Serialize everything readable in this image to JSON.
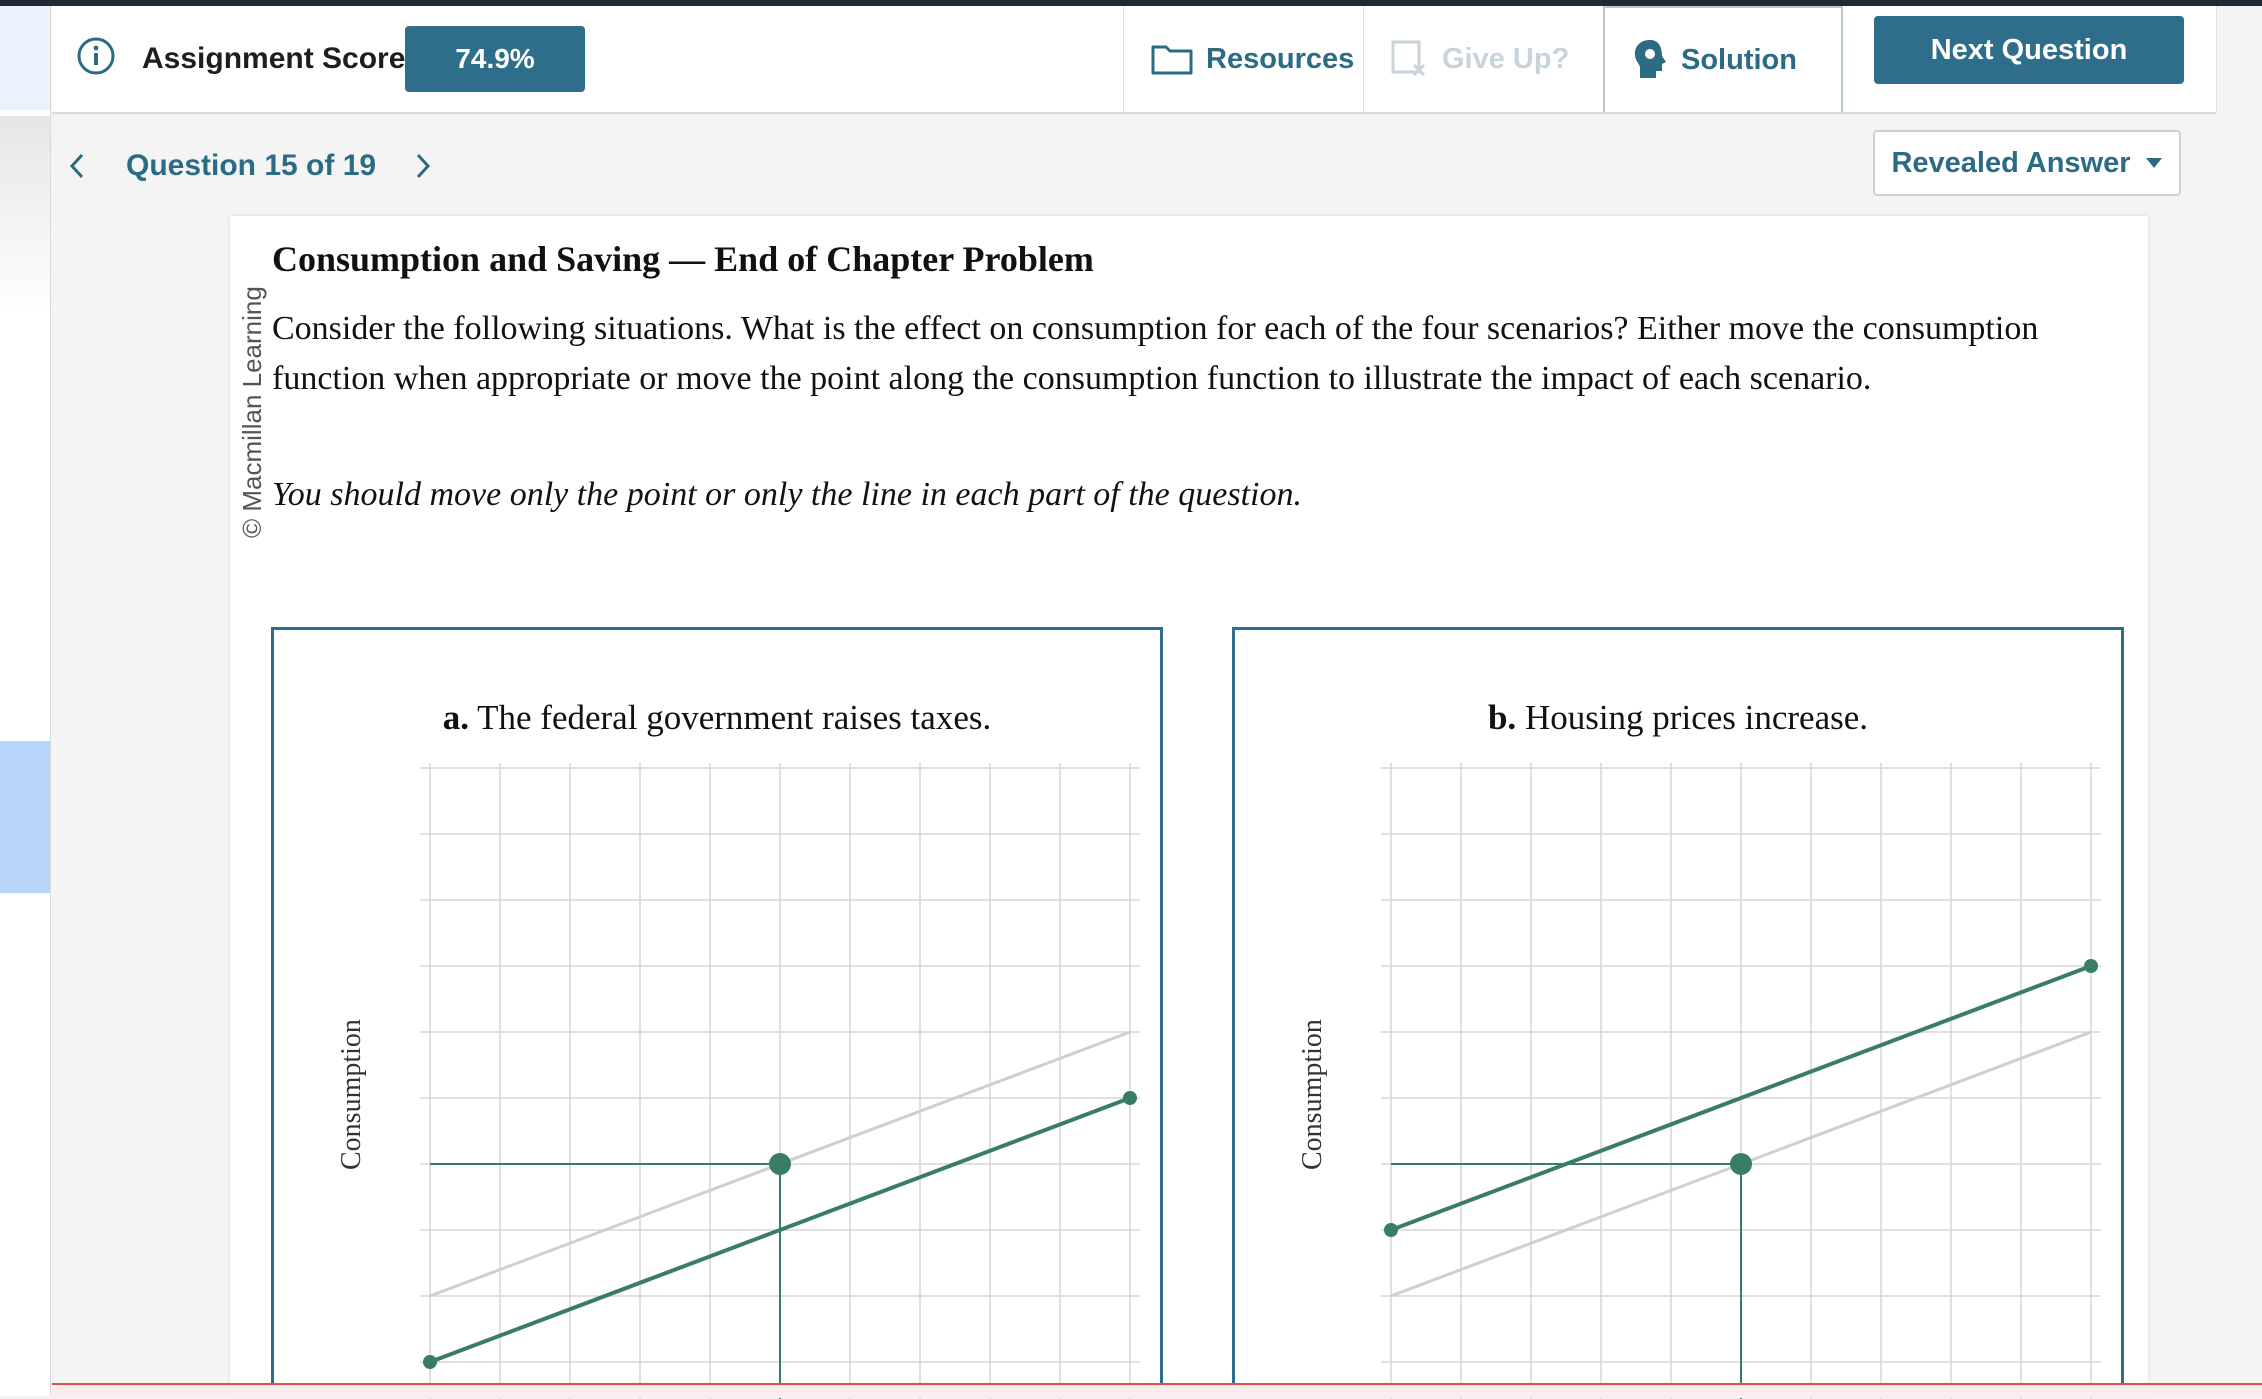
{
  "header": {
    "score_label": "Assignment Score:",
    "score_value": "74.9%",
    "resources_label": "Resources",
    "give_up_label": "Give Up?",
    "solution_label": "Solution",
    "next_label": "Next Question"
  },
  "nav": {
    "question_label": "Question 15 of 19",
    "revealed_label": "Revealed Answer"
  },
  "question": {
    "copyright": "© Macmillan Learning",
    "title": "Consumption and Saving — End of Chapter Problem",
    "body": "Consider the following situations. What is the effect on consumption for each of the four scenarios? Either move the consumption function when appropriate or move the point along the consumption function to illustrate the impact of each scenario.",
    "note": "You should move only the point or only the line in each part of the question."
  },
  "colors": {
    "accent": "#2e6e8b",
    "line": "#3a7d66",
    "original_line": "#cfcfcf",
    "grid": "#d6d6d6"
  },
  "chart_data": [
    {
      "type": "line",
      "title_prefix": "a.",
      "title_text": "The federal government raises taxes.",
      "ylabel": "Consumption",
      "xlim": [
        0,
        10
      ],
      "ylim": [
        0,
        9
      ],
      "series": [
        {
          "role": "original",
          "x": [
            0,
            10
          ],
          "y": [
            1,
            5
          ]
        },
        {
          "role": "moved",
          "x": [
            0,
            10
          ],
          "y": [
            0,
            4
          ]
        }
      ],
      "point": {
        "x": 5,
        "y": 3
      }
    },
    {
      "type": "line",
      "title_prefix": "b.",
      "title_text": "Housing prices increase.",
      "ylabel": "Consumption",
      "xlim": [
        0,
        10
      ],
      "ylim": [
        0,
        9
      ],
      "series": [
        {
          "role": "original",
          "x": [
            0,
            10
          ],
          "y": [
            1,
            5
          ]
        },
        {
          "role": "moved",
          "x": [
            0,
            10
          ],
          "y": [
            2,
            6
          ]
        }
      ],
      "point": {
        "x": 5,
        "y": 3
      }
    }
  ]
}
